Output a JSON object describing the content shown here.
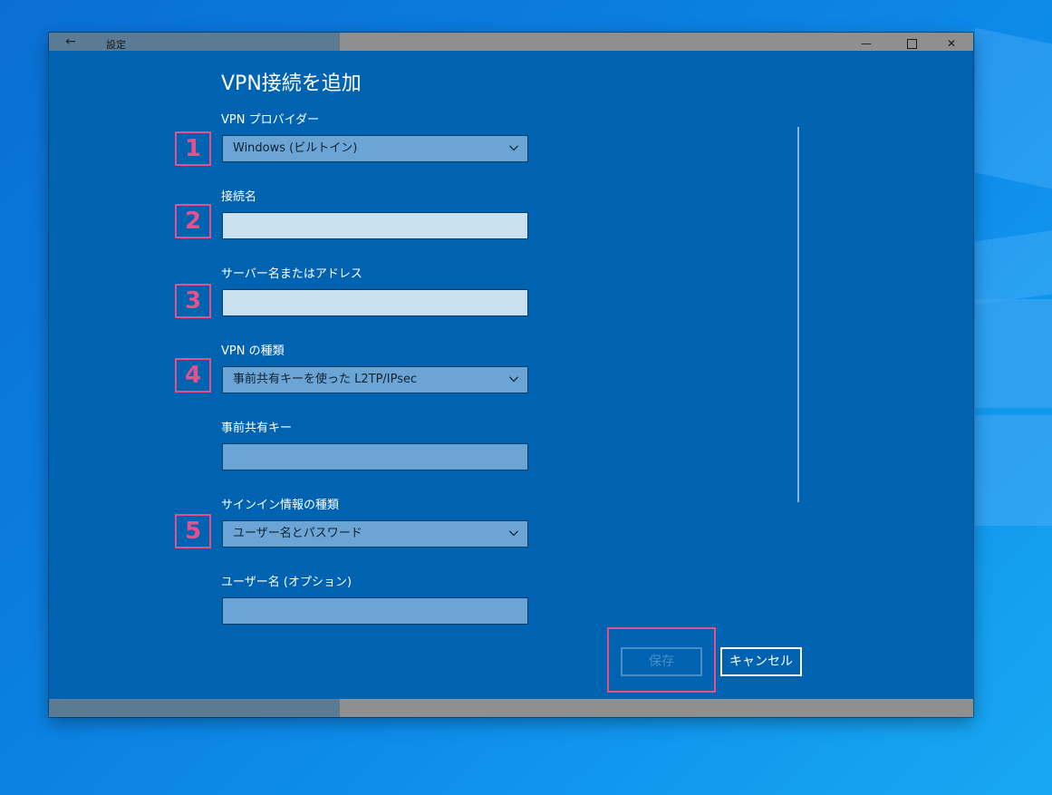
{
  "window": {
    "title": "設定",
    "back_glyph": "←",
    "minimize_glyph": "—",
    "close_glyph": "✕"
  },
  "dialog": {
    "title": "VPN接続を追加"
  },
  "fields": {
    "provider": {
      "label": "VPN プロバイダー",
      "value": "Windows (ビルトイン)"
    },
    "connection_name": {
      "label": "接続名",
      "value": ""
    },
    "server": {
      "label": "サーバー名またはアドレス",
      "value": ""
    },
    "vpn_type": {
      "label": "VPN の種類",
      "value": "事前共有キーを使った L2TP/IPsec"
    },
    "preshared_key": {
      "label": "事前共有キー",
      "value": ""
    },
    "signin_type": {
      "label": "サインイン情報の種類",
      "value": "ユーザー名とパスワード"
    },
    "username": {
      "label": "ユーザー名 (オプション)",
      "value": ""
    }
  },
  "annotations": {
    "n1": "1",
    "n2": "2",
    "n3": "3",
    "n4": "4",
    "n5": "5"
  },
  "buttons": {
    "save": "保存",
    "cancel": "キャンセル"
  },
  "colors": {
    "window_bg": "#0063b1",
    "annotation": "#e7508a",
    "field_bg": "#6aa5d6",
    "input_light_bg": "#c9e0f1"
  },
  "icons": {
    "back": "arrow-left-icon",
    "minimize": "minimize-icon",
    "maximize": "maximize-icon",
    "close": "close-icon",
    "dropdown": "chevron-down-icon"
  }
}
